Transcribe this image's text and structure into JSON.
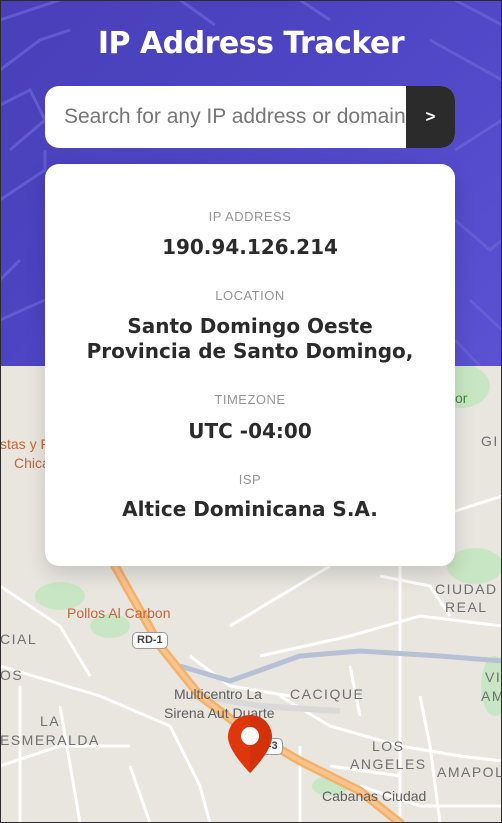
{
  "app": {
    "title": "IP Address Tracker"
  },
  "search": {
    "placeholder": "Search for any IP address or domain",
    "button_label": ">"
  },
  "info": {
    "ip_label": "IP ADDRESS",
    "ip_value": "190.94.126.214",
    "location_label": "LOCATION",
    "location_line1": "Santo Domingo Oeste",
    "location_line2": "Provincia de Santo Domingo,",
    "timezone_label": "TIMEZONE",
    "timezone_value": "UTC -04:00",
    "isp_label": "ISP",
    "isp_value": "Altice Dominicana S.A."
  },
  "map": {
    "labels": {
      "pollos": "Pollos Al Carbon",
      "rd1": "RD-1",
      "rd3": "RD-3",
      "multicentro1": "Multicentro La",
      "multicentro2": "Sirena Aut Duarte",
      "cacique": "CACIQUE",
      "los": "LOS",
      "angeles": "ANGELES",
      "la": "LA",
      "esmeralda": "ESMERALDA",
      "cial": "CIAL",
      "os": "OS",
      "ciudad": "CIUDAD",
      "real": "REAL",
      "amapol": "AMAPOL",
      "cabanas": "Cabanas Ciudad",
      "gi": "GI",
      "vi": "VI",
      "am": "AM",
      "or": "or",
      "tas_y": "stas y F",
      "chic": "Chica"
    },
    "colors": {
      "header_bg": "#4c44c2",
      "pin": "#e0360e",
      "highway": "#f5b06a",
      "poi_orange": "#c2653a"
    }
  }
}
